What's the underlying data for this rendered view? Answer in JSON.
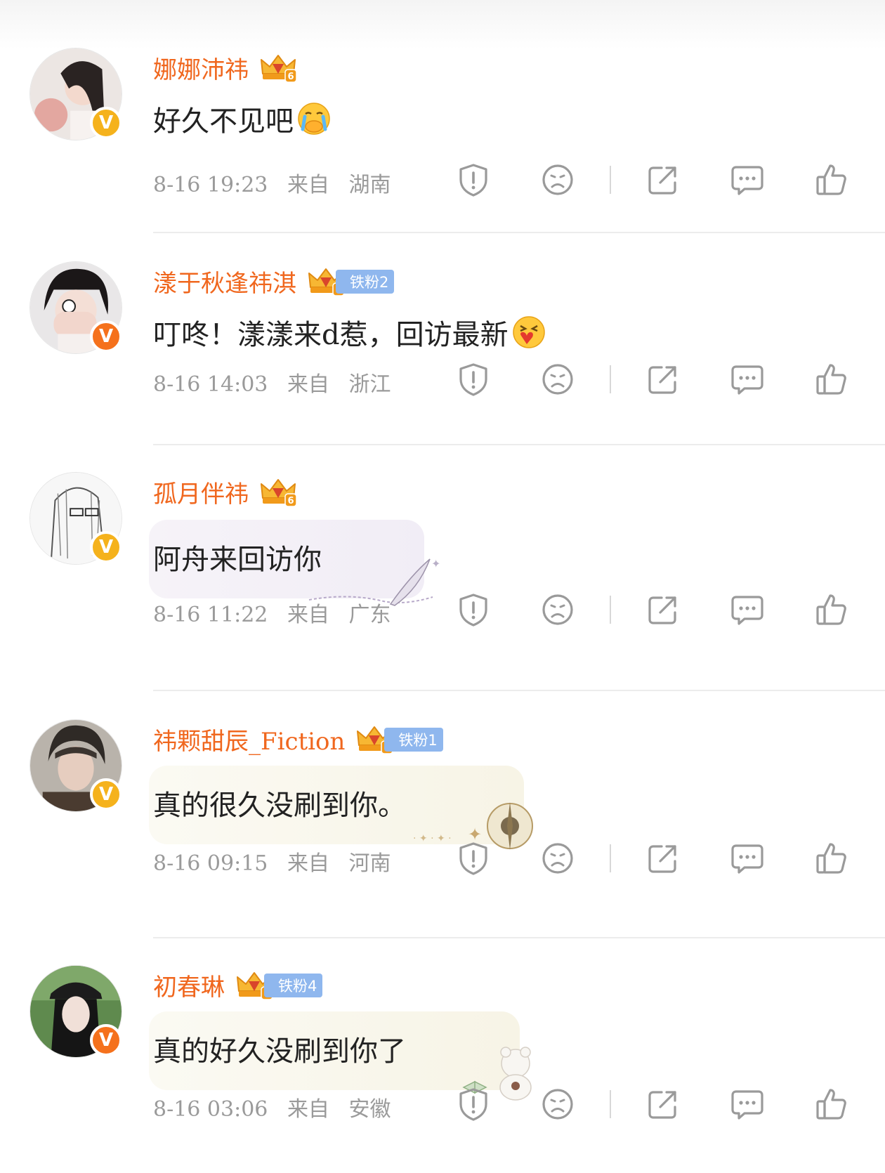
{
  "colors": {
    "username": "#f0671e",
    "fan_badge_bg": "#8fb7ee",
    "meta_text": "#9a9a9a",
    "icon_stroke": "#9a9a9a",
    "verified_gold": "#f5b21c",
    "verified_orange": "#f5711c"
  },
  "icons": {
    "verified": "V",
    "report": "shield-exclamation-icon",
    "dislike": "sad-face-icon",
    "share": "share-icon",
    "comment": "comment-bubble-icon",
    "like": "thumbs-up-icon",
    "crown": "crown-level-badge-icon"
  },
  "comments": [
    {
      "username": "娜娜沛祎",
      "fan_badge": "",
      "text": "好久不见吧",
      "emoji": "crying-cover-mouth-emoji",
      "time": "8-16 19:23",
      "from_label": "来自",
      "location": "湖南"
    },
    {
      "username": "漾于秋逢祎淇",
      "fan_badge": "铁粉2",
      "text": "叮咚！漾漾来d惹，回访最新",
      "emoji": "heart-excited-emoji",
      "time": "8-16 14:03",
      "from_label": "来自",
      "location": "浙江"
    },
    {
      "username": "孤月伴祎",
      "fan_badge": "",
      "text": "阿舟来回访你",
      "emoji": "",
      "time": "8-16 11:22",
      "from_label": "来自",
      "location": "广东"
    },
    {
      "username": "祎颗甜辰_Fiction",
      "fan_badge": "铁粉1",
      "text": "真的很久没刷到你。",
      "emoji": "",
      "time": "8-16 09:15",
      "from_label": "来自",
      "location": "河南"
    },
    {
      "username": "初春琳",
      "fan_badge": "铁粉4",
      "text": "真的好久没刷到你了",
      "emoji": "",
      "time": "8-16 03:06",
      "from_label": "来自",
      "location": "安徽"
    }
  ]
}
